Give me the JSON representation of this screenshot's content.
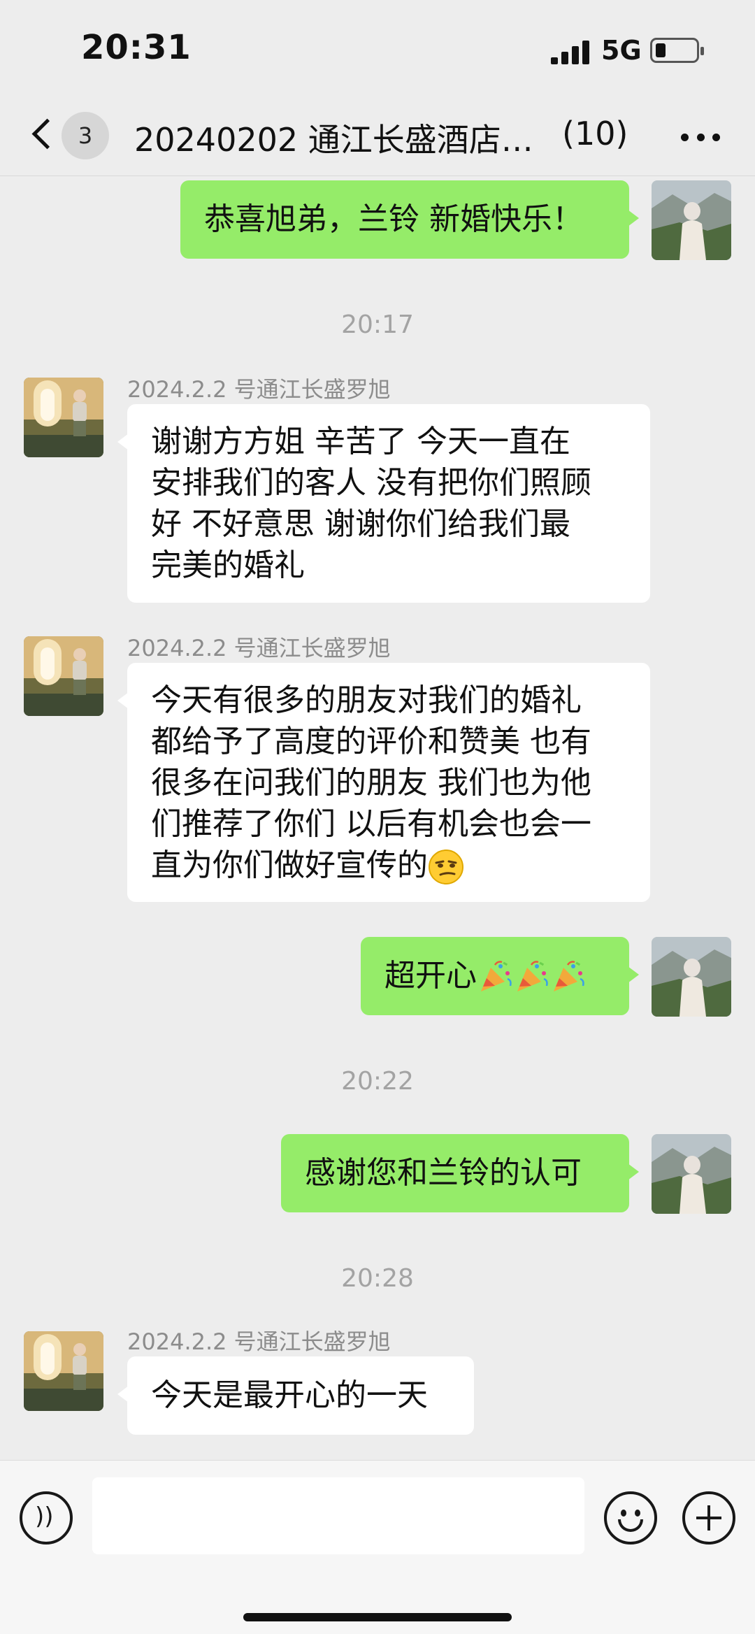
{
  "status_bar": {
    "time": "20:31",
    "network": "5G"
  },
  "header": {
    "unread_count": "3",
    "title": "20240202 通江长盛酒店…",
    "member_count": "(10)"
  },
  "messages": [
    {
      "from": "me",
      "text": "恭喜旭弟，兰铃 新婚快乐！"
    },
    {
      "timestamp": "20:17"
    },
    {
      "from": "other",
      "sender": "2024.2.2 号通江长盛罗旭",
      "lines": [
        "谢谢方方姐 辛苦了 今天一直在",
        "安排我们的客人 没有把你们照顾",
        "好 不好意思 谢谢你们给我们最",
        "完美的婚礼"
      ]
    },
    {
      "from": "other",
      "sender": "2024.2.2 号通江长盛罗旭",
      "lines": [
        "今天有很多的朋友对我们的婚礼",
        "都给予了高度的评价和赞美 也有",
        "很多在问我们的朋友 我们也为他",
        "们推荐了你们 以后有机会也会一",
        "直为你们做好宣传的"
      ],
      "trailing_emoji": "smirk-emoji"
    },
    {
      "from": "me",
      "text": "超开心",
      "emojis": [
        "party-popper-emoji",
        "party-popper-emoji",
        "party-popper-emoji"
      ]
    },
    {
      "timestamp": "20:22"
    },
    {
      "from": "me",
      "text": "感谢您和兰铃的认可"
    },
    {
      "timestamp": "20:28"
    },
    {
      "from": "other",
      "sender": "2024.2.2 号通江长盛罗旭",
      "text": "今天是最开心的一天"
    }
  ],
  "input_bar": {
    "voice_icon": "voice-icon",
    "emoji_icon": "smiley-icon",
    "plus_icon": "plus-icon"
  },
  "colors": {
    "background": "#ededed",
    "my_bubble": "#95ec69",
    "other_bubble": "#ffffff",
    "meta_text": "#a3a3a3"
  }
}
